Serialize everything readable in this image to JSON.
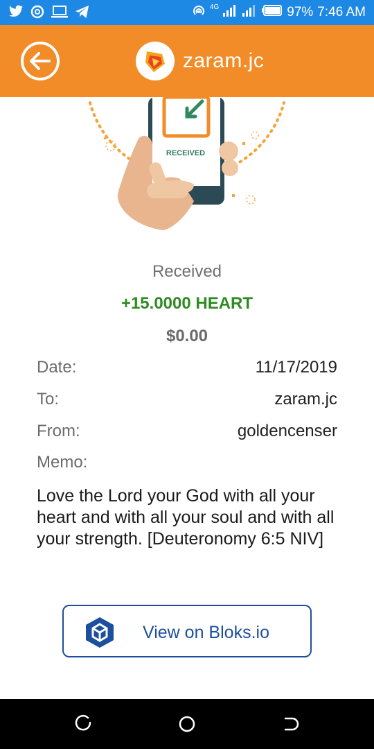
{
  "status_bar": {
    "network": "4G",
    "battery": "97%",
    "time": "7:46 AM"
  },
  "header": {
    "account": "zaram.jc"
  },
  "illustration": {
    "phone_label": "RECEIVED"
  },
  "transaction": {
    "status": "Received",
    "amount": "+15.0000 HEART",
    "usd_value": "$0.00",
    "date_label": "Date:",
    "date_value": "11/17/2019",
    "to_label": "To:",
    "to_value": "zaram.jc",
    "from_label": "From:",
    "from_value": "goldencenser",
    "memo_label": "Memo:",
    "memo_value": "Love the Lord your God with all your heart and with all your soul and with all your strength. [Deuteronomy 6:5 NIV]"
  },
  "actions": {
    "view_bloks_label": "View on Bloks.io"
  },
  "colors": {
    "status_bar": "#1e88e5",
    "app_bar": "#f28c28",
    "amount_green": "#2e8b22",
    "bloks_blue": "#1c4f9c"
  }
}
